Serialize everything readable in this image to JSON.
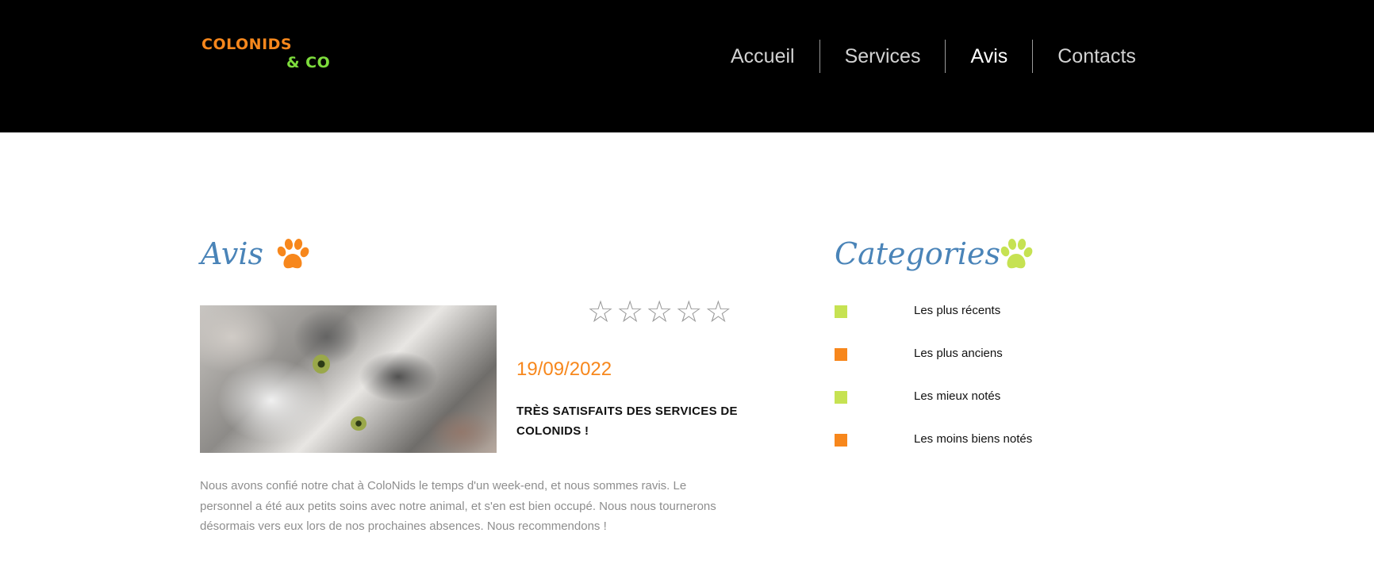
{
  "header": {
    "logo_line1": "COLONIDS",
    "logo_line2": "& CO",
    "nav": [
      {
        "label": "Accueil",
        "active": false
      },
      {
        "label": "Services",
        "active": false
      },
      {
        "label": "Avis",
        "active": true
      },
      {
        "label": "Contacts",
        "active": false
      }
    ]
  },
  "reviews": {
    "title": "Avis",
    "paw_color": "#f7871c",
    "items": [
      {
        "rating": 0,
        "rating_max": 5,
        "date": "19/09/2022",
        "headline": "TRÈS SATISFAITS DES SERVICES DE COLONIDS !",
        "body": "Nous avons confié notre chat à ColoNids le temps d'un week-end, et nous sommes ravis. Le personnel a été aux petits soins avec notre animal, et s'en est bien occupé. Nous nous tournerons désormais vers eux lors de nos prochaines absences. Nous recommendons !"
      }
    ]
  },
  "categories": {
    "title": "Categories",
    "paw_color": "#c6e252",
    "items": [
      {
        "label": "Les plus récents",
        "color": "#c6e252"
      },
      {
        "label": "Les plus anciens",
        "color": "#f7871c"
      },
      {
        "label": "Les mieux notés",
        "color": "#c6e252"
      },
      {
        "label": "Les moins biens notés",
        "color": "#f7871c"
      }
    ]
  },
  "colors": {
    "accent_orange": "#f7871c",
    "accent_green": "#c6e252",
    "title_blue": "#4a84b8",
    "header_bg": "#000000"
  }
}
